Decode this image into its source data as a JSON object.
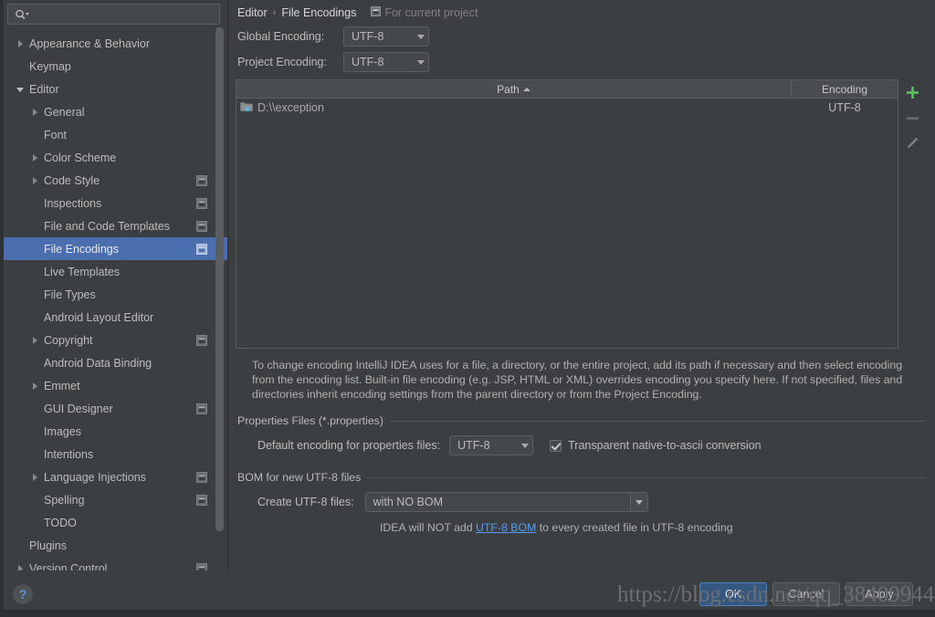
{
  "search": {
    "placeholder": "",
    "value": "",
    "icon": "search-icon"
  },
  "sidebar": {
    "items": [
      {
        "label": "Appearance & Behavior",
        "arrow": "collapsed",
        "indent": 0,
        "badge": false,
        "selected": false
      },
      {
        "label": "Keymap",
        "arrow": "none",
        "indent": 0,
        "badge": false,
        "selected": false
      },
      {
        "label": "Editor",
        "arrow": "expanded",
        "indent": 0,
        "badge": false,
        "selected": false
      },
      {
        "label": "General",
        "arrow": "collapsed",
        "indent": 1,
        "badge": false,
        "selected": false
      },
      {
        "label": "Font",
        "arrow": "none",
        "indent": 1,
        "badge": false,
        "selected": false
      },
      {
        "label": "Color Scheme",
        "arrow": "collapsed",
        "indent": 1,
        "badge": false,
        "selected": false
      },
      {
        "label": "Code Style",
        "arrow": "collapsed",
        "indent": 1,
        "badge": true,
        "selected": false
      },
      {
        "label": "Inspections",
        "arrow": "none",
        "indent": 1,
        "badge": true,
        "selected": false
      },
      {
        "label": "File and Code Templates",
        "arrow": "none",
        "indent": 1,
        "badge": true,
        "selected": false
      },
      {
        "label": "File Encodings",
        "arrow": "none",
        "indent": 1,
        "badge": true,
        "selected": true
      },
      {
        "label": "Live Templates",
        "arrow": "none",
        "indent": 1,
        "badge": false,
        "selected": false
      },
      {
        "label": "File Types",
        "arrow": "none",
        "indent": 1,
        "badge": false,
        "selected": false
      },
      {
        "label": "Android Layout Editor",
        "arrow": "none",
        "indent": 1,
        "badge": false,
        "selected": false
      },
      {
        "label": "Copyright",
        "arrow": "collapsed",
        "indent": 1,
        "badge": true,
        "selected": false
      },
      {
        "label": "Android Data Binding",
        "arrow": "none",
        "indent": 1,
        "badge": false,
        "selected": false
      },
      {
        "label": "Emmet",
        "arrow": "collapsed",
        "indent": 1,
        "badge": false,
        "selected": false
      },
      {
        "label": "GUI Designer",
        "arrow": "none",
        "indent": 1,
        "badge": true,
        "selected": false
      },
      {
        "label": "Images",
        "arrow": "none",
        "indent": 1,
        "badge": false,
        "selected": false
      },
      {
        "label": "Intentions",
        "arrow": "none",
        "indent": 1,
        "badge": false,
        "selected": false
      },
      {
        "label": "Language Injections",
        "arrow": "collapsed",
        "indent": 1,
        "badge": true,
        "selected": false
      },
      {
        "label": "Spelling",
        "arrow": "none",
        "indent": 1,
        "badge": true,
        "selected": false
      },
      {
        "label": "TODO",
        "arrow": "none",
        "indent": 1,
        "badge": false,
        "selected": false
      },
      {
        "label": "Plugins",
        "arrow": "none",
        "indent": 0,
        "badge": false,
        "selected": false
      },
      {
        "label": "Version Control",
        "arrow": "collapsed",
        "indent": 0,
        "badge": true,
        "selected": false
      }
    ]
  },
  "breadcrumb": {
    "parent": "Editor",
    "separator": "›",
    "current": "File Encodings",
    "scope_badge": "For current project"
  },
  "encoding": {
    "global_label": "Global Encoding:",
    "global_value": "UTF-8",
    "project_label": "Project Encoding:",
    "project_value": "UTF-8"
  },
  "table": {
    "columns": {
      "path": "Path",
      "encoding": "Encoding"
    },
    "sort_indicator": "▲",
    "rows": [
      {
        "path": "D:\\\\exception",
        "encoding": "UTF-8"
      }
    ],
    "toolbar": {
      "add": "add-icon",
      "remove": "remove-icon",
      "edit": "edit-icon"
    }
  },
  "description": "To change encoding IntelliJ IDEA uses for a file, a directory, or the entire project, add its path if necessary and then select encoding from the encoding list. Built-in file encoding (e.g. JSP, HTML or XML) overrides encoding you specify here. If not specified, files and directories inherit encoding settings from the parent directory or from the Project Encoding.",
  "properties_group": {
    "title": "Properties Files (*.properties)",
    "default_encoding_label": "Default encoding for properties files:",
    "default_encoding_value": "UTF-8",
    "transparent_label": "Transparent native-to-ascii conversion",
    "transparent_checked": true
  },
  "bom_group": {
    "title": "BOM for new UTF-8 files",
    "create_label": "Create UTF-8 files:",
    "create_value": "with NO BOM",
    "hint_prefix": "IDEA will NOT add ",
    "hint_link": "UTF-8 BOM",
    "hint_suffix": " to every created file in UTF-8 encoding"
  },
  "footer": {
    "help": "?",
    "ok": "OK",
    "cancel": "Cancel",
    "apply": "Apply"
  },
  "watermark": "https://blog.csdn.net/qq_38409944",
  "colors": {
    "selection": "#4b6eaf",
    "default_button": "#365880",
    "link": "#589df6",
    "add_green": "#58c45a",
    "panel_bg": "#3c3f41"
  }
}
